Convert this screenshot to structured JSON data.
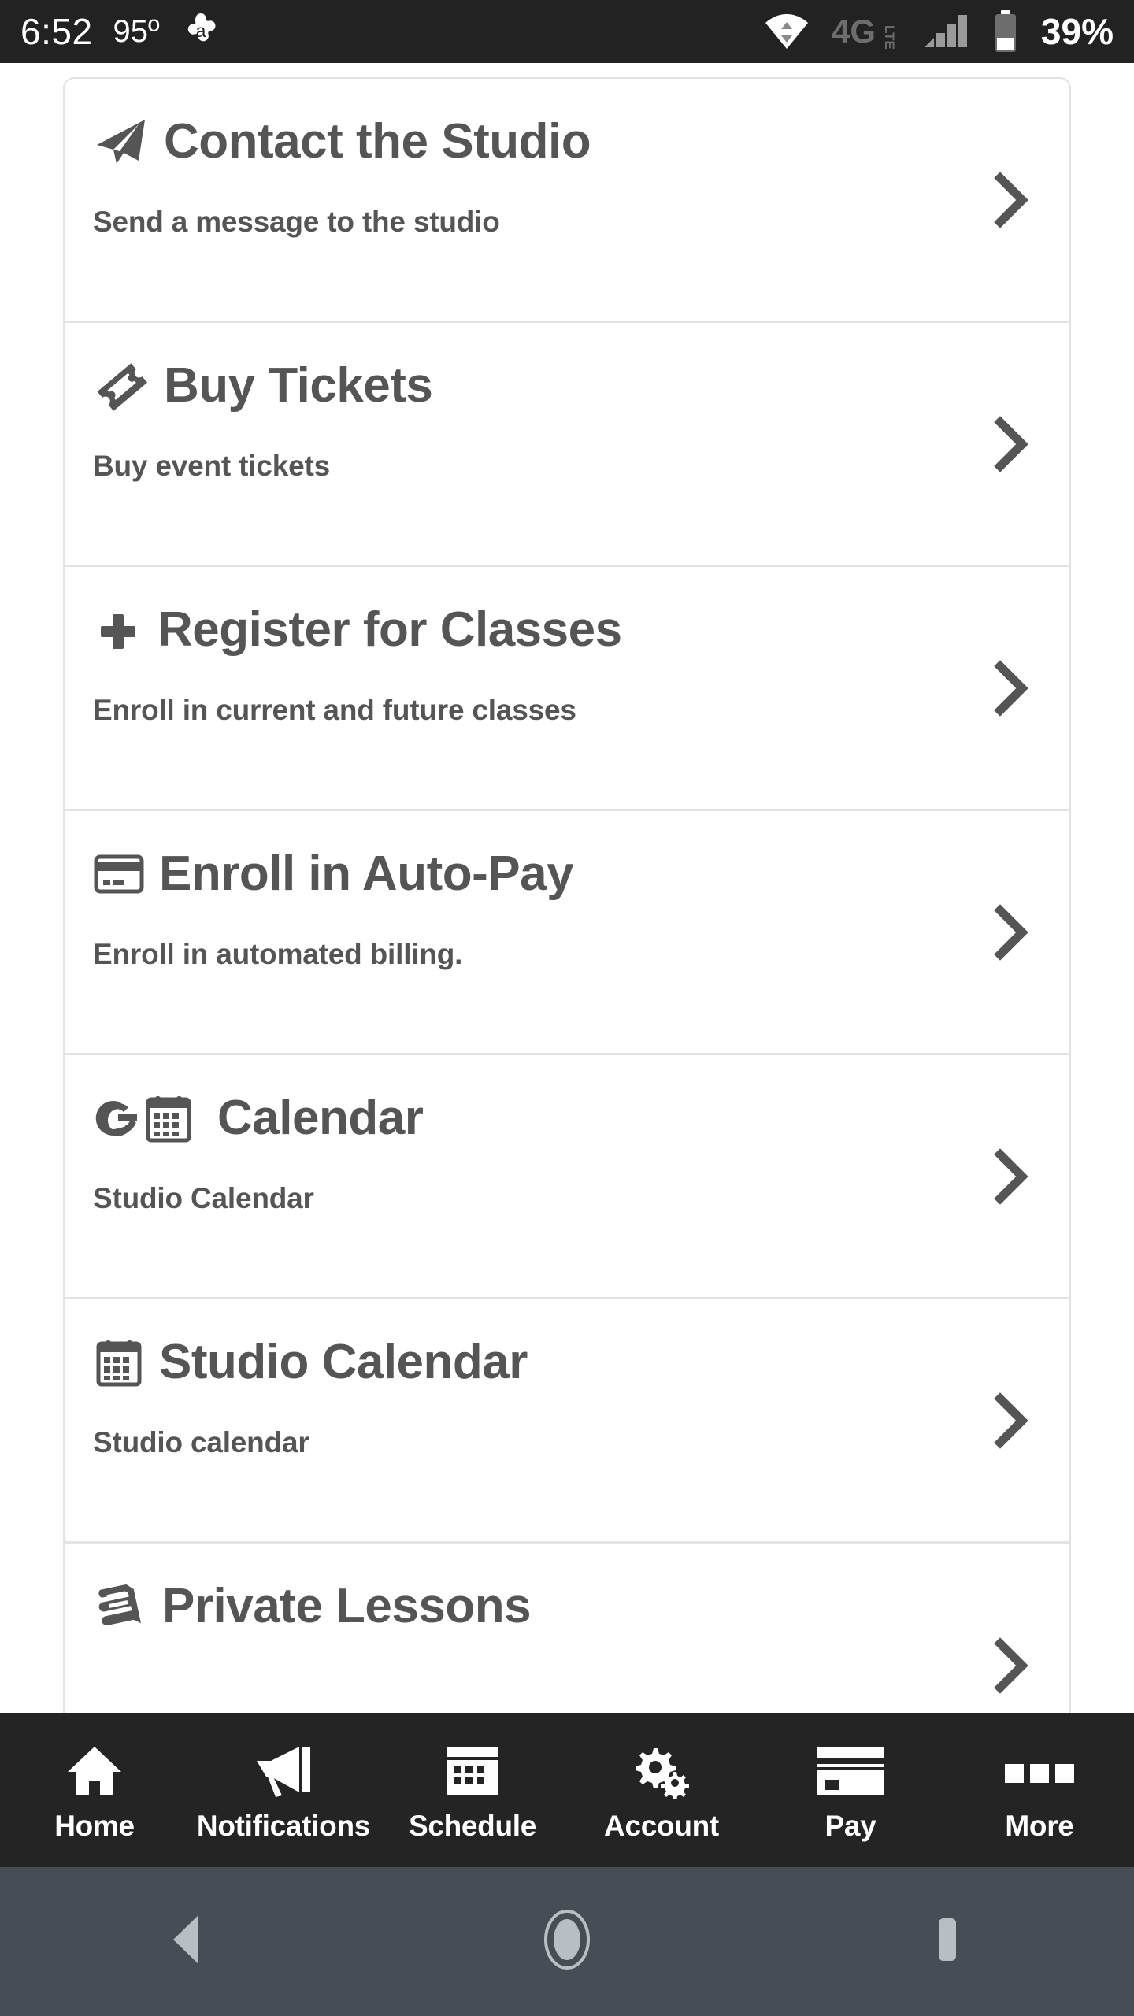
{
  "status_bar": {
    "time": "6:52",
    "temperature": "95º",
    "notification_icon": "avast-icon",
    "wifi_icon": "wifi-icon",
    "network_type": "4G LTE",
    "signal_icon": "signal-bars-icon",
    "battery_icon": "battery-icon",
    "battery_percent": "39%",
    "background": "#222222",
    "foreground": "#ffffff"
  },
  "menu": {
    "items": [
      {
        "icon": "paper-plane-icon",
        "title": "Contact the Studio",
        "subtitle": "Send a message to the studio",
        "chevron": "chevron-right-icon"
      },
      {
        "icon": "ticket-icon",
        "title": "Buy Tickets",
        "subtitle": "Buy event tickets",
        "chevron": "chevron-right-icon"
      },
      {
        "icon": "plus-icon",
        "title": "Register for Classes",
        "subtitle": "Enroll in current and future classes",
        "chevron": "chevron-right-icon"
      },
      {
        "icon": "credit-card-icon",
        "title": "Enroll in Auto-Pay",
        "subtitle": "Enroll in automated billing.",
        "chevron": "chevron-right-icon"
      },
      {
        "icon": "google-calendar-icon",
        "title": "Calendar",
        "subtitle": "Studio Calendar",
        "chevron": "chevron-right-icon"
      },
      {
        "icon": "calendar-icon",
        "title": "Studio Calendar",
        "subtitle": "Studio calendar",
        "chevron": "chevron-right-icon"
      },
      {
        "icon": "book-icon",
        "title": "Private Lessons",
        "subtitle": "",
        "chevron": "chevron-right-icon"
      }
    ],
    "text_color": "#555555",
    "divider_color": "#e4e4e4",
    "card_background": "#ffffff"
  },
  "bottom_nav": {
    "background": "#242424",
    "items": [
      {
        "icon": "home-icon",
        "label": "Home"
      },
      {
        "icon": "megaphone-icon",
        "label": "Notifications"
      },
      {
        "icon": "calendar-grid-icon",
        "label": "Schedule"
      },
      {
        "icon": "gears-icon",
        "label": "Account"
      },
      {
        "icon": "credit-card-icon",
        "label": "Pay"
      },
      {
        "icon": "three-squares-icon",
        "label": "More"
      }
    ]
  },
  "system_nav": {
    "background": "#464d54",
    "buttons": [
      {
        "icon": "back-triangle-icon"
      },
      {
        "icon": "home-circle-icon"
      },
      {
        "icon": "recents-square-icon"
      }
    ]
  }
}
